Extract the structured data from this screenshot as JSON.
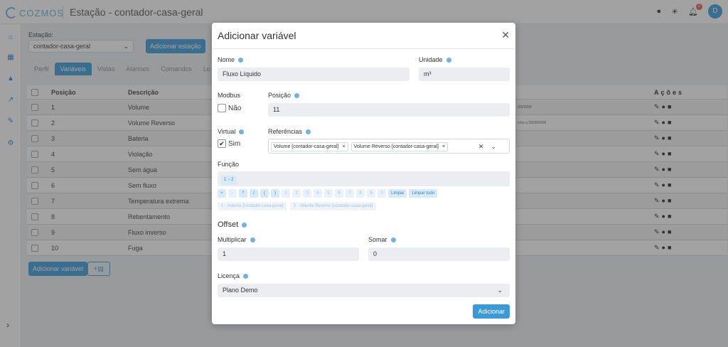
{
  "app": {
    "logo": "COZMOS",
    "title": "Estação - contador-casa-geral",
    "notification_count": "2",
    "avatar_initial": "D"
  },
  "page": {
    "station_label": "Estação:",
    "station_value": "contador-casa-geral",
    "add_station_label": "Adicionar estação",
    "tabs": [
      "Perfil",
      "Variáveis",
      "Vistas",
      "Alarmes",
      "Comandos",
      "Lo"
    ],
    "table": {
      "headers": {
        "position": "Posição",
        "description": "Descrição",
        "actions": "Ações"
      },
      "rows": [
        {
          "pos": "1",
          "desc": "Volume",
          "note": "(08/0998"
        },
        {
          "pos": "2",
          "desc": "Volume Reverso",
          "note": "ento a 28/08/0998"
        },
        {
          "pos": "3",
          "desc": "Bateria",
          "note": ""
        },
        {
          "pos": "4",
          "desc": "Violação",
          "note": ""
        },
        {
          "pos": "5",
          "desc": "Sem água",
          "note": ""
        },
        {
          "pos": "6",
          "desc": "Sem fluxo",
          "note": ""
        },
        {
          "pos": "7",
          "desc": "Temperatura extrema",
          "note": ""
        },
        {
          "pos": "8",
          "desc": "Rebentamento",
          "note": ""
        },
        {
          "pos": "9",
          "desc": "Fluxo inverso",
          "note": ""
        },
        {
          "pos": "10",
          "desc": "Fuga",
          "note": ""
        }
      ]
    },
    "add_variable_label": "Adicionar variável"
  },
  "modal": {
    "title": "Adicionar variável",
    "name_label": "Nome",
    "name_value": "Fluxo Líquido",
    "unit_label": "Unidade",
    "unit_value": "m³",
    "modbus_label": "Modbus",
    "modbus_option": "Não",
    "position_label": "Posição",
    "position_value": "11",
    "virtual_label": "Virtual",
    "virtual_option": "Sim",
    "references_label": "Referências",
    "references": [
      "Volume [contador-casa-geral]",
      "Volume Reverso [contador-casa-geral]"
    ],
    "function_label": "Função",
    "function_value": "1 − 2",
    "ops": [
      "+",
      "-",
      "*",
      "/",
      "(",
      ")",
      "1",
      "2",
      "3",
      "4",
      "5",
      "6",
      "7",
      "8",
      "9",
      "0"
    ],
    "clear_label": "Limpar",
    "clear_all_label": "Limpar tudo",
    "ref_chips": [
      "1 - Volume [contador-casa-geral]",
      "2 - Volume Reverso [contador-casa-geral]"
    ],
    "offset_label": "Offset",
    "multiply_label": "Multiplicar",
    "multiply_value": "1",
    "add_label": "Somar",
    "add_value": "0",
    "license_label": "Licença",
    "license_value": "Plano Demo",
    "submit_label": "Adicionar"
  }
}
